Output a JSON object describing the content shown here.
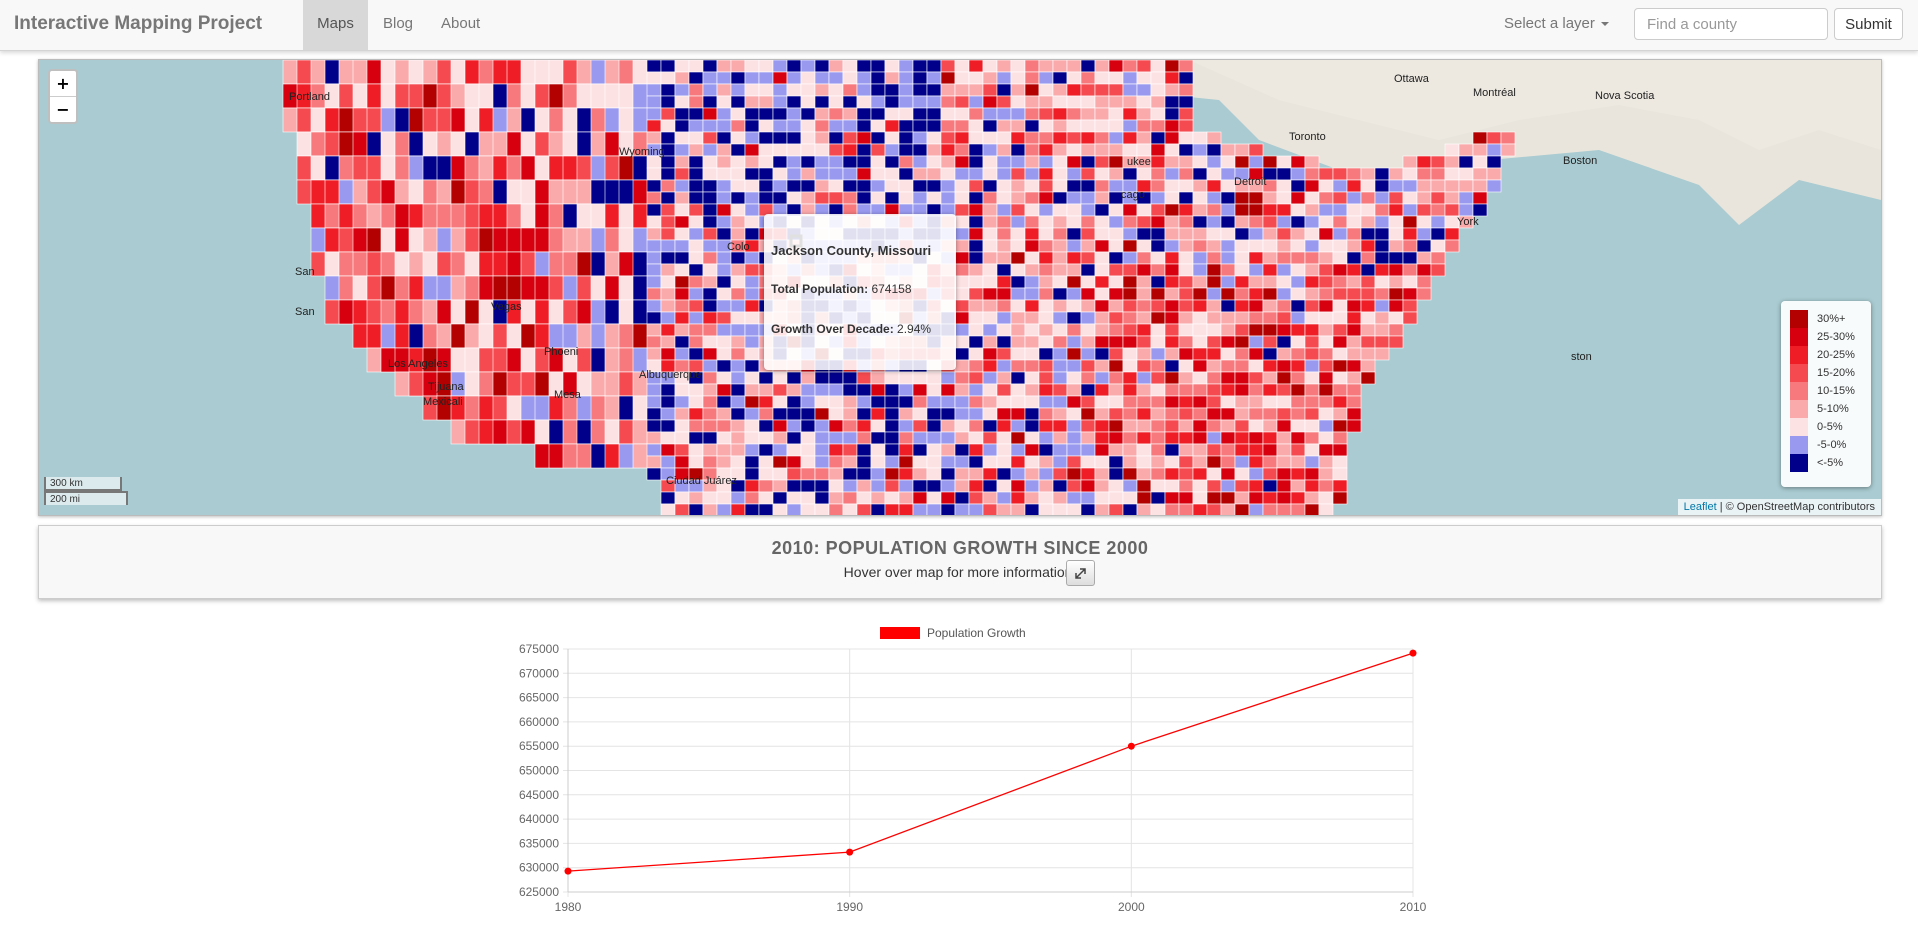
{
  "navbar": {
    "brand": "Interactive Mapping Project",
    "tabs": [
      {
        "label": "Maps",
        "active": true
      },
      {
        "label": "Blog",
        "active": false
      },
      {
        "label": "About",
        "active": false
      }
    ],
    "layer_select_label": "Select a layer",
    "search_placeholder": "Find a county",
    "submit_label": "Submit"
  },
  "map": {
    "zoom_in": "+",
    "zoom_out": "−",
    "scale_km": "300 km",
    "scale_mi": "200 mi",
    "attribution_leaflet": "Leaflet",
    "attribution_rest": " | © OpenStreetMap contributors",
    "place_labels": [
      "Ottawa",
      "Montréal",
      "Toronto",
      "Nova Scotia",
      "ukee",
      "cago",
      "Detroit",
      "York",
      "Portland",
      "Wyoming",
      "Colo",
      "San",
      "San",
      "Vegas",
      "Phoeni",
      "Mesa",
      "Los Angeles",
      "Tijuana",
      "Mexicali",
      "Ciudad Juárez",
      "Albuquerque",
      "ston",
      "Boston"
    ],
    "tooltip": {
      "title": "Jackson County, Missouri",
      "population_label": "Total Population:",
      "population_value": "674158",
      "growth_label": "Growth Over Decade:",
      "growth_value": "2.94%"
    },
    "legend": [
      {
        "label": "30%+",
        "color": "#b30000"
      },
      {
        "label": "25-30%",
        "color": "#d7000e"
      },
      {
        "label": "20-25%",
        "color": "#ef1e26"
      },
      {
        "label": "15-20%",
        "color": "#f44a50"
      },
      {
        "label": "10-15%",
        "color": "#f7797d"
      },
      {
        "label": "5-10%",
        "color": "#fbaaac"
      },
      {
        "label": "0-5%",
        "color": "#fde2e3"
      },
      {
        "label": "-5-0%",
        "color": "#9999f0"
      },
      {
        "label": "<-5%",
        "color": "#00008b"
      }
    ]
  },
  "info": {
    "title": "2010: POPULATION GROWTH SINCE 2000",
    "hover_text": "Hover over map for more information."
  },
  "chart_data": {
    "type": "line",
    "legend": "Population Growth",
    "line_color": "#ff0000",
    "x": [
      1980,
      1990,
      2000,
      2010
    ],
    "y": [
      629300,
      633200,
      655000,
      674158
    ],
    "ylim": [
      625000,
      675000
    ],
    "yticks": [
      625000,
      630000,
      635000,
      640000,
      645000,
      650000,
      655000,
      660000,
      665000,
      670000,
      675000
    ],
    "xticks": [
      1980,
      1990,
      2000,
      2010
    ],
    "grid": true,
    "legend_position": "top-center"
  }
}
